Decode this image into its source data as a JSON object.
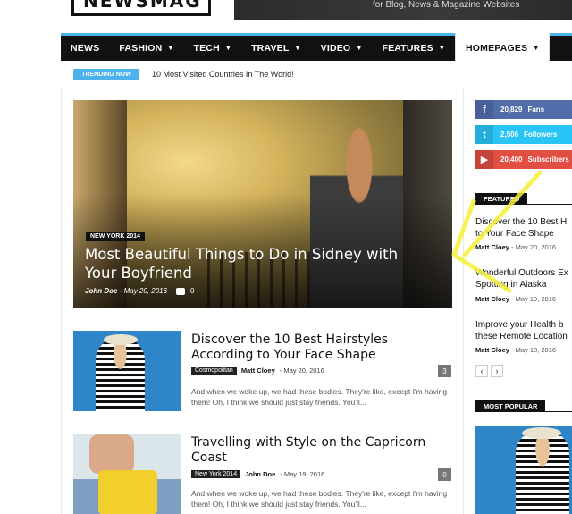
{
  "header": {
    "logo": "NEWSMAG",
    "banner_text": "for Blog, News & Magazine Websites"
  },
  "nav": {
    "items": [
      {
        "label": "NEWS",
        "dropdown": false
      },
      {
        "label": "FASHION",
        "dropdown": true
      },
      {
        "label": "TECH",
        "dropdown": true
      },
      {
        "label": "TRAVEL",
        "dropdown": true
      },
      {
        "label": "VIDEO",
        "dropdown": true
      },
      {
        "label": "FEATURES",
        "dropdown": true
      },
      {
        "label": "HOMEPAGES",
        "dropdown": true
      }
    ],
    "chevron": "▼"
  },
  "trending": {
    "badge": "TRENDING NOW",
    "text": "10 Most Visited Countries In The World!"
  },
  "hero": {
    "tag": "NEW YORK 2014",
    "title": "Most Beautiful Things to Do in Sidney with Your Boyfriend",
    "author": "John Doe",
    "date": "- May 20, 2016",
    "comments": "0"
  },
  "articles": [
    {
      "title": "Discover the 10 Best Hairstyles According to Your Face Shape",
      "category": "Cosmopolitan",
      "author": "Matt Cloey",
      "date": "- May 20, 2016",
      "comments": "3",
      "excerpt": "And when we woke up, we had these bodies. They're like, except I'm having them! Oh, I think we should just stay friends. You'll..."
    },
    {
      "title": "Travelling with Style on the Capricorn Coast",
      "category": "New York 2014",
      "author": "John Doe",
      "date": "- May 19, 2016",
      "comments": "0",
      "excerpt": "And when we woke up, we had these bodies. They're like, except I'm having them! Oh, I think we should just stay friends. You'll..."
    }
  ],
  "social": {
    "facebook": {
      "count": "20,829",
      "label": "Fans",
      "icon": "f"
    },
    "twitter": {
      "count": "2,506",
      "label": "Followers",
      "icon": "t"
    },
    "youtube": {
      "count": "20,400",
      "label": "Subscribers",
      "icon": "▶"
    }
  },
  "featured": {
    "heading": "FEATURED",
    "items": [
      {
        "title_line1": "Discover the 10 Best H",
        "title_line2": "to Your Face Shape",
        "author": "Matt Cloey",
        "date": "- May 20, 2016"
      },
      {
        "title_line1": "Wonderful Outdoors Ex",
        "title_line2": "Spotting in Alaska",
        "author": "Matt Cloey",
        "date": "- May 19, 2016"
      },
      {
        "title_line1": "Improve your Health b",
        "title_line2": "these Remote Location",
        "author": "Matt Cloey",
        "date": "- May 18, 2016"
      }
    ],
    "prev": "‹",
    "next": "›"
  },
  "most_popular": {
    "heading": "MOST POPULAR"
  },
  "colors": {
    "accent": "#4db2ec",
    "facebook": "#516eab",
    "twitter": "#29c5f6",
    "youtube": "#e14e42",
    "annotation": "#f5f03a"
  }
}
